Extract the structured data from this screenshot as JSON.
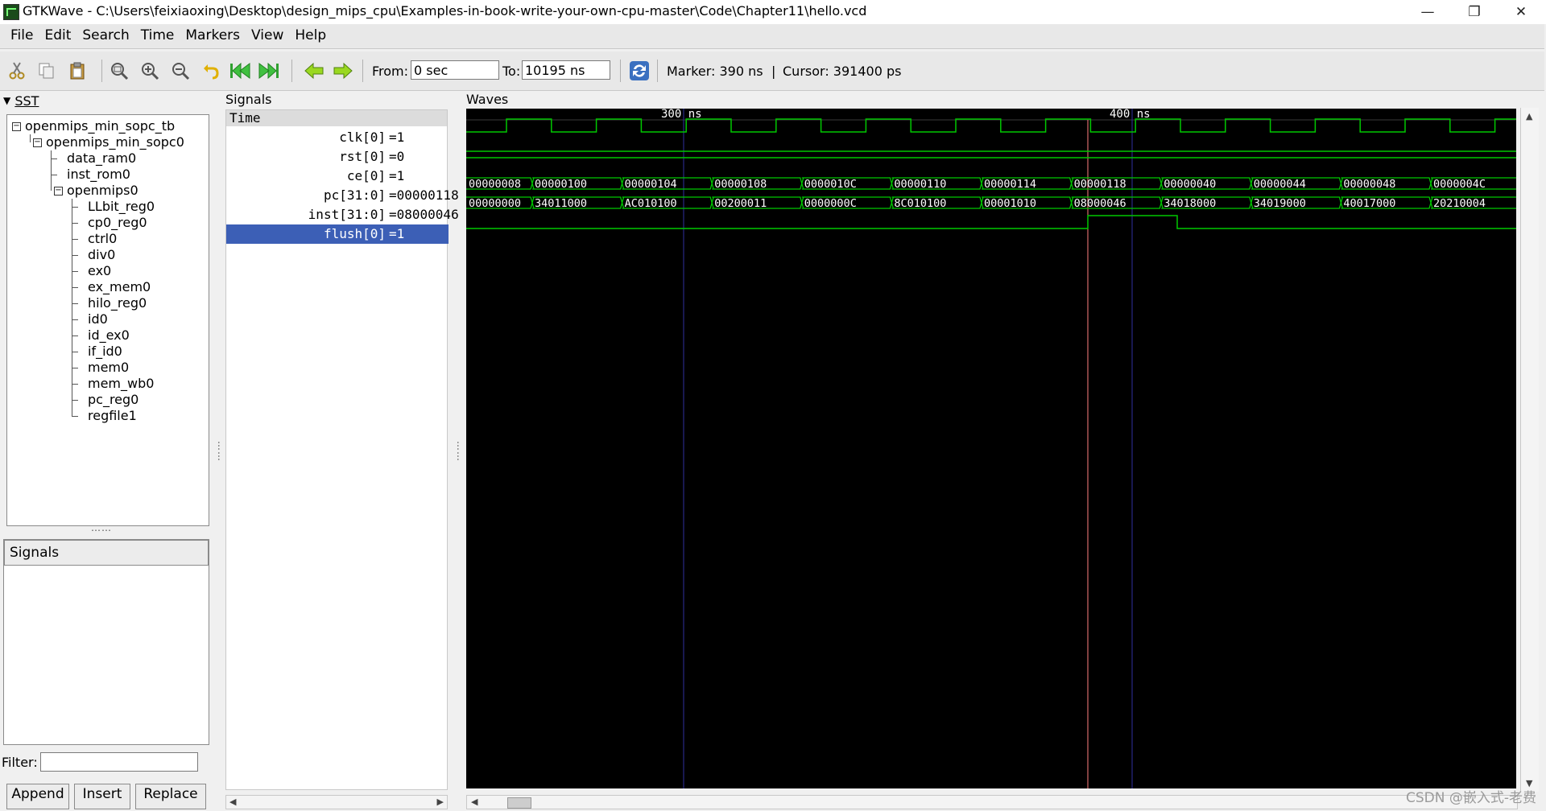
{
  "window": {
    "title": "GTKWave - C:\\Users\\feixiaoxing\\Desktop\\design_mips_cpu\\Examples-in-book-write-your-own-cpu-master\\Code\\Chapter11\\hello.vcd",
    "minimize_glyph": "—",
    "restore_glyph": "❐",
    "close_glyph": "✕"
  },
  "menu": [
    "File",
    "Edit",
    "Search",
    "Time",
    "Markers",
    "View",
    "Help"
  ],
  "toolbar": {
    "from_label": "From:",
    "from_value": "0 sec",
    "to_label": "To:",
    "to_value": "10195 ns",
    "marker_text": "Marker: 390 ns",
    "separator": "|",
    "cursor_text": "Cursor: 391400 ps"
  },
  "sst": {
    "title": "SST",
    "tree": [
      {
        "label": "openmips_min_sopc_tb",
        "depth": 0,
        "expander": "⊟"
      },
      {
        "label": "openmips_min_sopc0",
        "depth": 1,
        "expander": "⊟"
      },
      {
        "label": "data_ram0",
        "depth": 2
      },
      {
        "label": "inst_rom0",
        "depth": 2
      },
      {
        "label": "openmips0",
        "depth": 2,
        "expander": "⊟"
      },
      {
        "label": "LLbit_reg0",
        "depth": 3
      },
      {
        "label": "cp0_reg0",
        "depth": 3
      },
      {
        "label": "ctrl0",
        "depth": 3
      },
      {
        "label": "div0",
        "depth": 3
      },
      {
        "label": "ex0",
        "depth": 3
      },
      {
        "label": "ex_mem0",
        "depth": 3
      },
      {
        "label": "hilo_reg0",
        "depth": 3
      },
      {
        "label": "id0",
        "depth": 3
      },
      {
        "label": "id_ex0",
        "depth": 3
      },
      {
        "label": "if_id0",
        "depth": 3
      },
      {
        "label": "mem0",
        "depth": 3
      },
      {
        "label": "mem_wb0",
        "depth": 3
      },
      {
        "label": "pc_reg0",
        "depth": 3
      },
      {
        "label": "regfile1",
        "depth": 3
      }
    ],
    "signals_header": "Signals",
    "filter_label": "Filter:",
    "filter_value": "",
    "buttons": [
      "Append",
      "Insert",
      "Replace"
    ]
  },
  "signals_panel": {
    "title": "Signals",
    "time_header": "Time",
    "rows": [
      {
        "name": "clk[0]",
        "value": "=1",
        "selected": false
      },
      {
        "name": "rst[0]",
        "value": "=0",
        "selected": false
      },
      {
        "name": "ce[0]",
        "value": "=1",
        "selected": false
      },
      {
        "name": "pc[31:0]",
        "value": "=00000118",
        "selected": false
      },
      {
        "name": "inst[31:0]",
        "value": "=08000046",
        "selected": false
      },
      {
        "name": "flush[0]",
        "value": "=1",
        "selected": true
      }
    ]
  },
  "waves": {
    "title": "Waves",
    "time_labels": [
      "300 ns",
      "400 ns"
    ],
    "pc_values": [
      "00000008",
      "00000100",
      "00000104",
      "00000108",
      "0000010C",
      "00000110",
      "00000114",
      "00000118",
      "00000040",
      "00000044",
      "00000048",
      "0000004C"
    ],
    "inst_values": [
      "00000000",
      "34011000",
      "AC010100",
      "00200011",
      "0000000C",
      "8C010100",
      "00001010",
      "08000046",
      "34018000",
      "34019000",
      "40017000",
      "20210004"
    ],
    "colors": {
      "wave": "#00c800",
      "background": "#000000",
      "grid": "#3030a0",
      "cursor": "#ff8080",
      "marker": "#3a3ab0",
      "text": "#ffffff"
    }
  },
  "watermark": "CSDN @嵌入式-老费"
}
